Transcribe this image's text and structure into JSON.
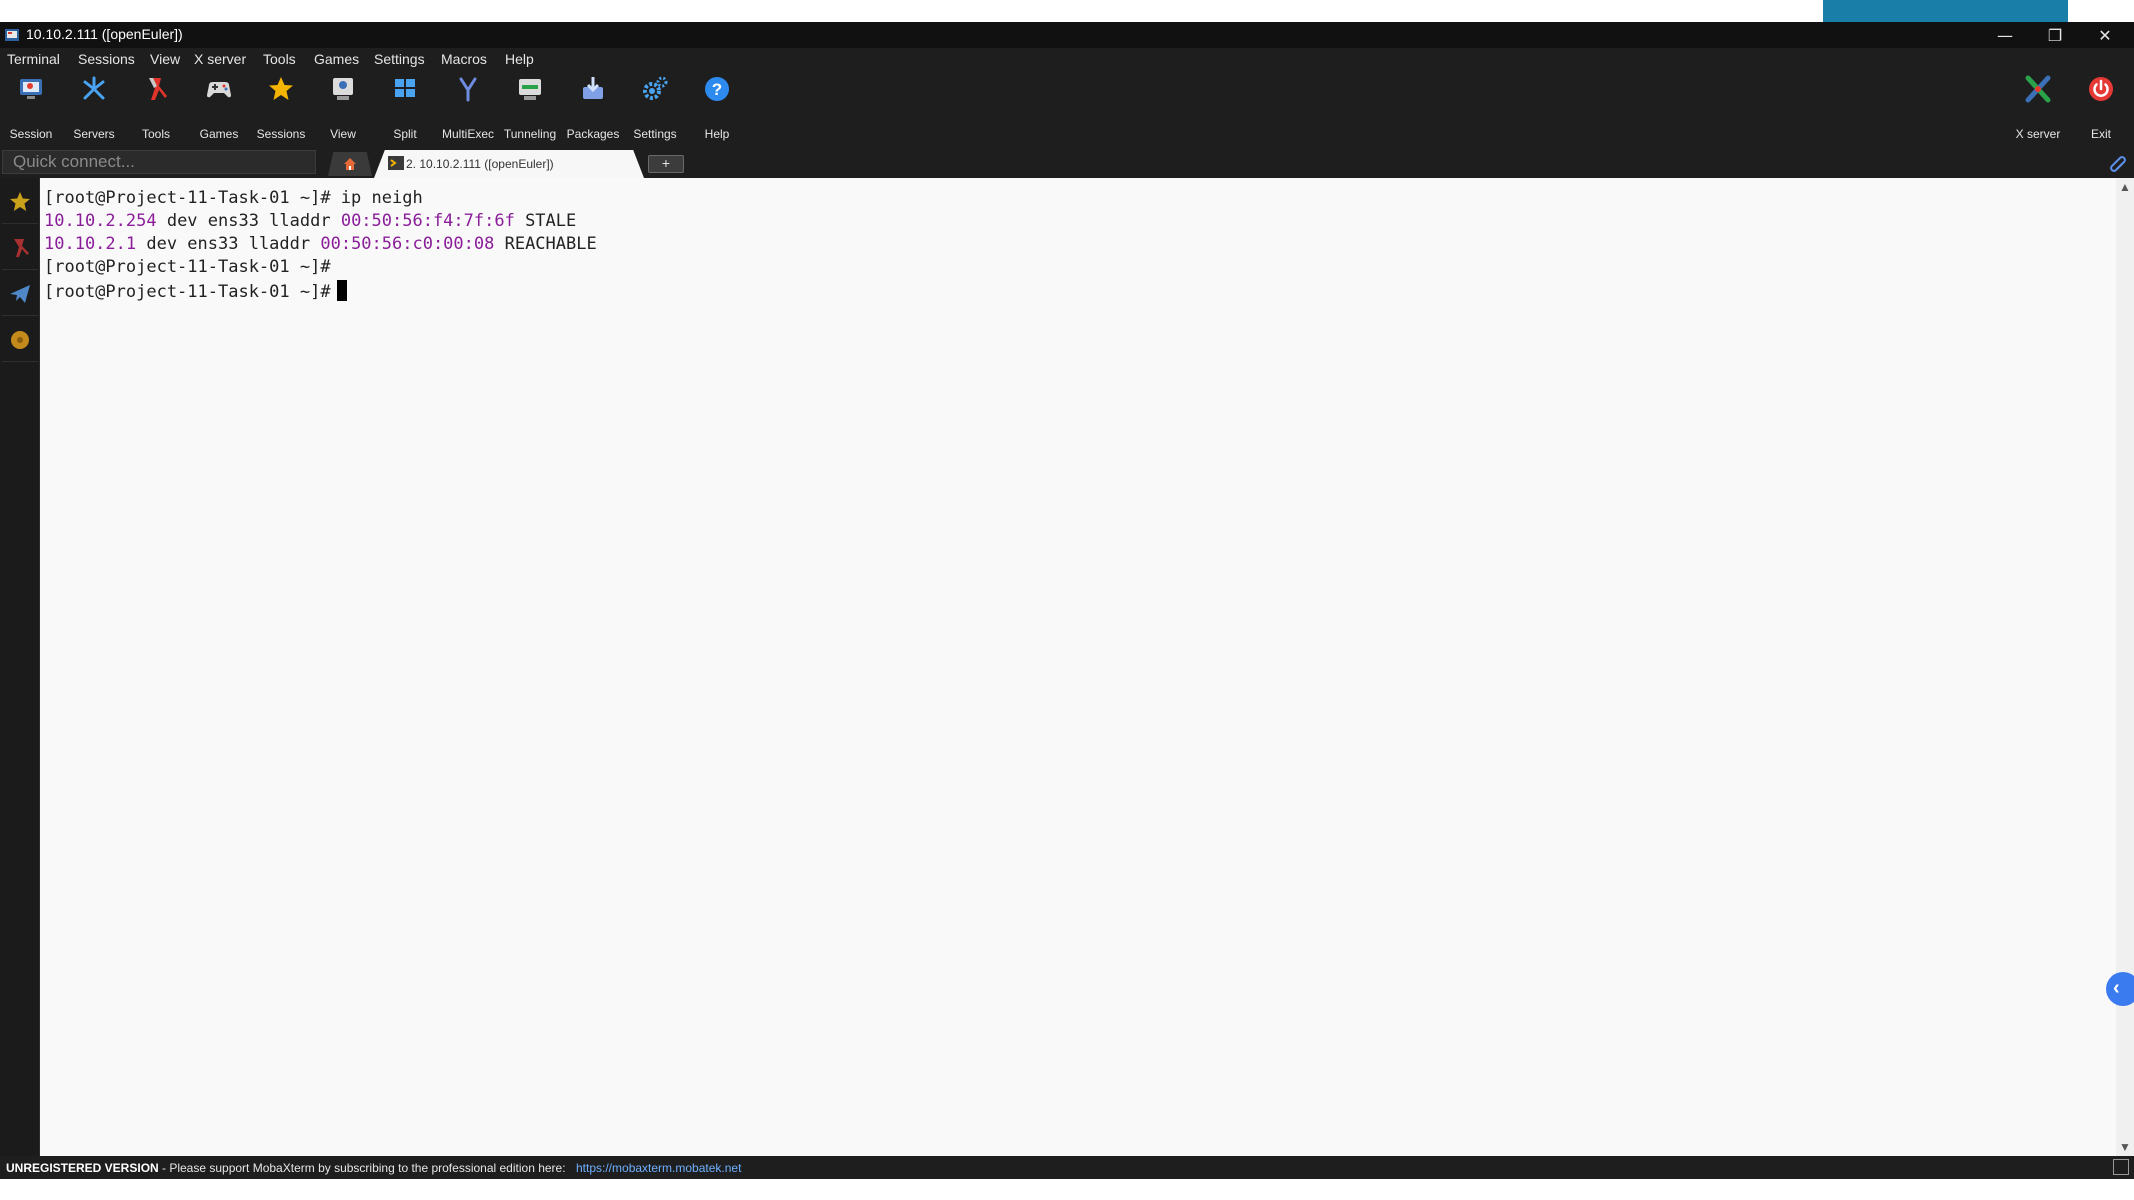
{
  "window": {
    "title": "10.10.2.111 ([openEuler])",
    "minimize_symbol": "—",
    "restore_symbol": "❐",
    "close_symbol": "✕"
  },
  "menu": [
    "Terminal",
    "Sessions",
    "View",
    "X server",
    "Tools",
    "Games",
    "Settings",
    "Macros",
    "Help"
  ],
  "toolbar": {
    "items": [
      {
        "label": "Session",
        "icon": "session-icon"
      },
      {
        "label": "Servers",
        "icon": "servers-icon"
      },
      {
        "label": "Tools",
        "icon": "tools-icon"
      },
      {
        "label": "Games",
        "icon": "games-icon"
      },
      {
        "label": "Sessions",
        "icon": "sessions-star-icon"
      },
      {
        "label": "View",
        "icon": "view-icon"
      },
      {
        "label": "Split",
        "icon": "split-icon"
      },
      {
        "label": "MultiExec",
        "icon": "multiexec-icon"
      },
      {
        "label": "Tunneling",
        "icon": "tunneling-icon"
      },
      {
        "label": "Packages",
        "icon": "packages-icon"
      },
      {
        "label": "Settings",
        "icon": "settings-icon"
      },
      {
        "label": "Help",
        "icon": "help-icon"
      }
    ],
    "right_items": [
      {
        "label": "X server",
        "icon": "xserver-icon"
      },
      {
        "label": "Exit",
        "icon": "power-icon"
      }
    ]
  },
  "quick_connect": {
    "placeholder": "Quick connect..."
  },
  "tabs": {
    "session_tab_label": "2. 10.10.2.111 ([openEuler])",
    "add_symbol": "+"
  },
  "terminal": {
    "lines": [
      {
        "parts": [
          {
            "text": "[root@Project-11-Task-01 ~]# ip neigh",
            "color": "#222222"
          }
        ]
      },
      {
        "parts": [
          {
            "text": "10.10.2.254",
            "color": "#8b1d9a"
          },
          {
            "text": " dev ens33 lladdr ",
            "color": "#222222"
          },
          {
            "text": "00:50:56:f4:7f:6f",
            "color": "#8b1d9a"
          },
          {
            "text": " STALE",
            "color": "#222222"
          }
        ]
      },
      {
        "parts": [
          {
            "text": "10.10.2.1",
            "color": "#8b1d9a"
          },
          {
            "text": " dev ens33 lladdr ",
            "color": "#222222"
          },
          {
            "text": "00:50:56:c0:00:08",
            "color": "#8b1d9a"
          },
          {
            "text": " REACHABLE",
            "color": "#222222"
          }
        ]
      },
      {
        "parts": [
          {
            "text": "[root@Project-11-Task-01 ~]#",
            "color": "#222222"
          }
        ]
      },
      {
        "parts": [
          {
            "text": "[root@Project-11-Task-01 ~]#",
            "color": "#222222"
          }
        ],
        "cursor": true
      }
    ]
  },
  "statusbar": {
    "unregistered": "UNREGISTERED VERSION",
    "message": "-  Please support MobaXterm by subscribing to the professional edition here:",
    "link": "https://mobaxterm.mobatek.net"
  },
  "colors": {
    "terminal_bg": "#f9f9f9",
    "highlight_purple": "#8b1d9a",
    "chrome_dark": "#1e1e1e",
    "link_blue": "#6fb0ff"
  }
}
